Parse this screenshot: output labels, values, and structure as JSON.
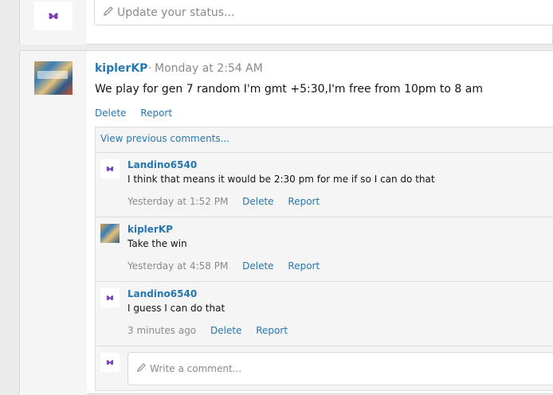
{
  "status": {
    "placeholder": "Update your status..."
  },
  "post": {
    "author": "kiplerKP",
    "separator": "·",
    "time": "Monday at 2:54 AM",
    "message": "We play for gen 7 random I'm gmt +5:30,I'm free from 10pm to 8 am",
    "actions": [
      "Delete",
      "Report"
    ]
  },
  "comments_section": {
    "view_previous": "View previous comments...",
    "comments": [
      {
        "user": "Landino6540",
        "text": "I think that means it would be 2:30 pm for me if so I can do that",
        "time": "Yesterday at 1:52 PM",
        "delete": "Delete",
        "report": "Report"
      },
      {
        "user": "kiplerKP",
        "text": "Take the win",
        "time": "Yesterday at 4:58 PM",
        "delete": "Delete",
        "report": "Report"
      },
      {
        "user": "Landino6540",
        "text": "I guess I can do that",
        "time": "3 minutes ago",
        "delete": "Delete",
        "report": "Report"
      }
    ],
    "reply_placeholder": "Write a comment..."
  },
  "colors": {
    "link": "#2577b1",
    "muted": "#8a8a8a",
    "avatar_purple": "#7a3fb3"
  }
}
